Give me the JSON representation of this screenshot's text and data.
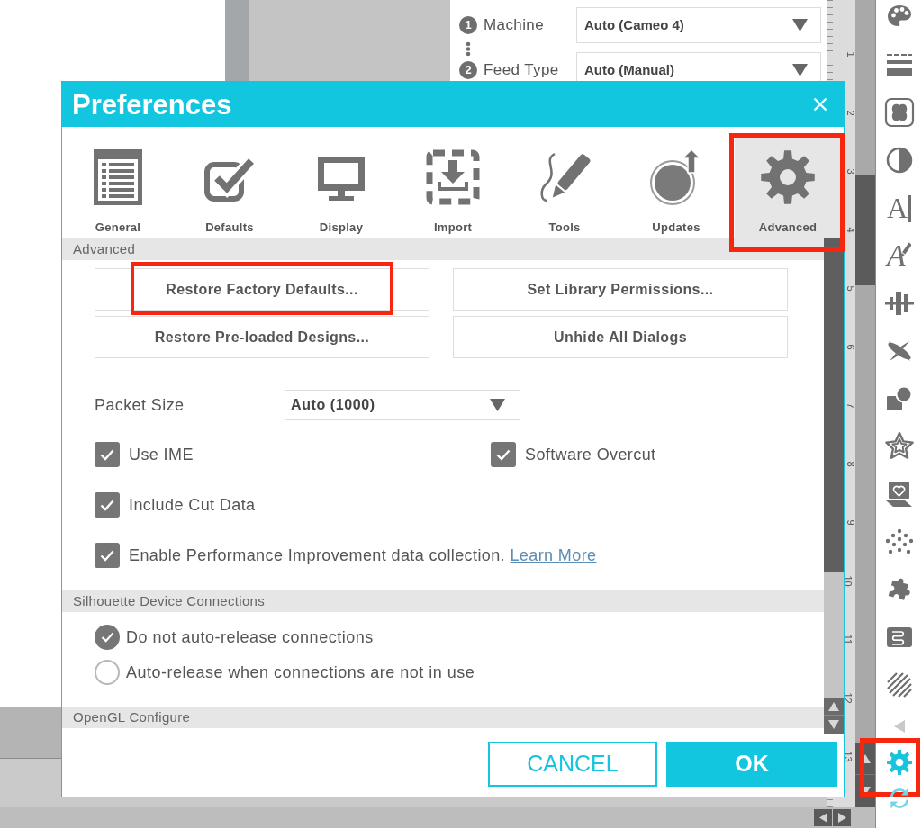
{
  "send_panel": {
    "steps": [
      {
        "number": "1",
        "label": "Machine",
        "value": "Auto (Cameo 4)"
      },
      {
        "number": "2",
        "label": "Feed Type",
        "value": "Auto (Manual)"
      }
    ]
  },
  "ruler": {
    "labels": [
      "1",
      "2",
      "3",
      "4",
      "5",
      "6",
      "7",
      "8",
      "9",
      "10",
      "11",
      "12",
      "13"
    ]
  },
  "toolbar": [
    {
      "kind": "icon",
      "highlighted": false
    },
    {
      "kind": "icon",
      "highlighted": false
    },
    {
      "kind": "icon",
      "highlighted": false
    },
    {
      "kind": "icon",
      "highlighted": false
    },
    {
      "kind": "letter",
      "glyph": "A",
      "highlighted": false
    },
    {
      "kind": "letter",
      "glyph": "A",
      "highlighted": false
    },
    {
      "kind": "icon",
      "highlighted": false
    },
    {
      "kind": "icon",
      "highlighted": false
    },
    {
      "kind": "icon",
      "highlighted": false
    },
    {
      "kind": "icon",
      "highlighted": false
    },
    {
      "kind": "icon",
      "highlighted": false
    },
    {
      "kind": "icon",
      "highlighted": false
    },
    {
      "kind": "icon",
      "highlighted": false
    },
    {
      "kind": "icon",
      "highlighted": false
    },
    {
      "kind": "icon",
      "highlighted": false
    },
    {
      "kind": "icon",
      "highlighted": false
    },
    {
      "kind": "icon",
      "highlighted": true
    },
    {
      "kind": "icon",
      "highlighted": false
    }
  ],
  "dialog": {
    "title": "Preferences",
    "tabs": [
      {
        "label": "General",
        "selected": false,
        "highlighted": false
      },
      {
        "label": "Defaults",
        "selected": false,
        "highlighted": false
      },
      {
        "label": "Display",
        "selected": false,
        "highlighted": false
      },
      {
        "label": "Import",
        "selected": false,
        "highlighted": false
      },
      {
        "label": "Tools",
        "selected": false,
        "highlighted": false
      },
      {
        "label": "Updates",
        "selected": false,
        "highlighted": false
      },
      {
        "label": "Advanced",
        "selected": true,
        "highlighted": true
      }
    ],
    "sections": [
      {
        "kind": "advanced",
        "header": "Advanced",
        "buttons": [
          {
            "label": "Restore Factory Defaults...",
            "highlighted": true
          },
          {
            "label": "Set Library Permissions...",
            "highlighted": false
          },
          {
            "label": "Restore Pre-loaded Designs...",
            "highlighted": false
          },
          {
            "label": "Unhide All Dialogs",
            "highlighted": false
          }
        ],
        "packet_size": {
          "label": "Packet Size",
          "value": "Auto (1000)"
        },
        "options": [
          {
            "label": "Use IME",
            "checked": true
          },
          {
            "label": "Software Overcut",
            "checked": true
          },
          {
            "label": "Include Cut Data",
            "checked": true
          },
          {
            "label": "Enable Performance Improvement data collection.",
            "link": "Learn More",
            "checked": true
          }
        ]
      },
      {
        "kind": "radios",
        "header": "Silhouette Device Connections",
        "options": [
          {
            "label": "Do not auto-release connections",
            "selected": true
          },
          {
            "label": "Auto-release when connections are not in use",
            "selected": false
          }
        ]
      },
      {
        "kind": "collapsed",
        "header": "OpenGL Configure"
      }
    ],
    "buttons": [
      {
        "label": "CANCEL",
        "kind": "secondary"
      },
      {
        "label": "OK",
        "kind": "primary"
      }
    ]
  }
}
